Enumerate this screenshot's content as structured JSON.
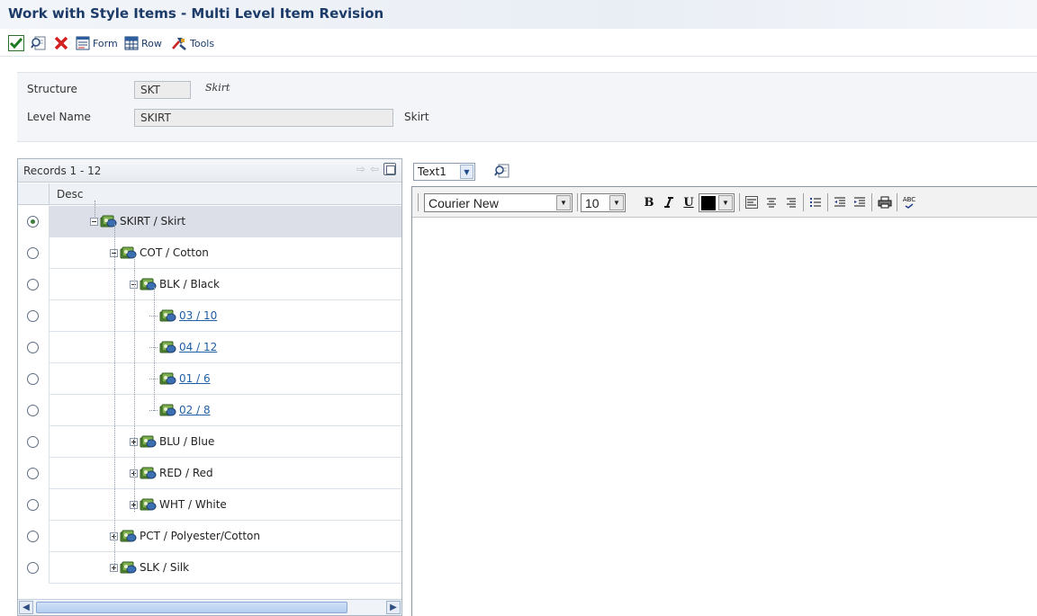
{
  "window": {
    "title": "Work with Style Items - Multi Level Item Revision"
  },
  "toolbar": {
    "ok_icon": "check-icon",
    "find_icon": "find-icon",
    "cancel_icon": "close-icon",
    "form_label": "Form",
    "row_label": "Row",
    "tools_label": "Tools"
  },
  "header": {
    "structure_label": "Structure",
    "structure_value": "SKT",
    "structure_desc": "Skirt",
    "level_name_label": "Level Name",
    "level_name_value": "SKIRT",
    "level_name_desc": "Skirt"
  },
  "grid": {
    "records_label": "Records 1 - 12",
    "column_desc": "Desc",
    "rows": [
      {
        "text": "SKIRT / Skirt",
        "selected": true,
        "link": false
      },
      {
        "text": "COT / Cotton",
        "selected": false,
        "link": false
      },
      {
        "text": "BLK / Black",
        "selected": false,
        "link": false
      },
      {
        "text": "03 / 10",
        "selected": false,
        "link": true
      },
      {
        "text": "04 / 12",
        "selected": false,
        "link": true
      },
      {
        "text": "01 / 6",
        "selected": false,
        "link": true
      },
      {
        "text": "02 / 8",
        "selected": false,
        "link": true
      },
      {
        "text": "BLU / Blue",
        "selected": false,
        "link": false
      },
      {
        "text": "RED / Red",
        "selected": false,
        "link": false
      },
      {
        "text": "WHT / White",
        "selected": false,
        "link": false
      },
      {
        "text": "PCT / Polyester/Cotton",
        "selected": false,
        "link": false
      },
      {
        "text": "SLK / Silk",
        "selected": false,
        "link": false
      }
    ],
    "scroll_thumb_label": "III"
  },
  "editor": {
    "text_select_value": "Text1",
    "font_family_value": "Courier New",
    "font_size_value": "10",
    "bold_label": "B",
    "italic_label": "I",
    "underline_label": "U",
    "spell_label": "ABC"
  },
  "colors": {
    "title": "#1d3b69",
    "link": "#1f5fa5",
    "selected_row": "#dcdfe8"
  }
}
